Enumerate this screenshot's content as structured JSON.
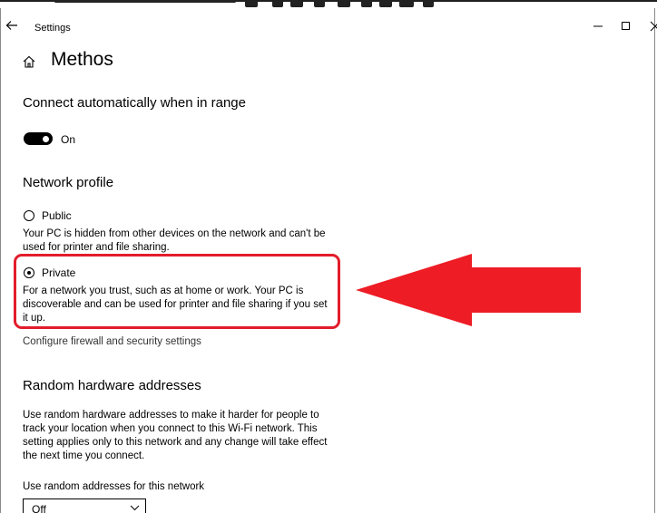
{
  "window": {
    "title": "Settings"
  },
  "page": {
    "title": "Methos"
  },
  "connect_auto": {
    "heading": "Connect automatically when in range",
    "toggle_state": "On"
  },
  "network_profile": {
    "heading": "Network profile",
    "options": [
      {
        "label": "Public",
        "checked": false,
        "description_lines": [
          "Your PC is hidden from other devices on the network and can't be",
          "used for printer and file sharing."
        ]
      },
      {
        "label": "Private",
        "checked": true,
        "description_lines": [
          "For a network you trust, such as at home or work. Your PC is",
          "discoverable and can be used for printer and file sharing if you set",
          "it up."
        ]
      }
    ],
    "firewall_link": "Configure firewall and security settings"
  },
  "random_hw": {
    "heading": "Random hardware addresses",
    "description_lines": [
      "Use random hardware addresses to make it harder for people to",
      "track your location when you connect to this Wi-Fi network. This",
      "setting applies only to this network and any change will take effect",
      "the next time you connect."
    ],
    "select_label": "Use random addresses for this network",
    "select_value": "Off"
  },
  "annotation": {
    "highlight_color": "#e21d2b",
    "arrow_color": "#ee1c25"
  }
}
